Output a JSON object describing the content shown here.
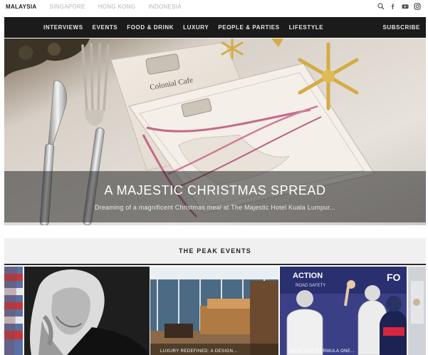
{
  "regions": {
    "items": [
      "MALAYSIA",
      "SINGAPORE",
      "HONG KONG",
      "INDONESIA"
    ],
    "active": "MALAYSIA"
  },
  "social": [
    "search-icon",
    "facebook-icon",
    "youtube-icon",
    "instagram-icon"
  ],
  "nav": {
    "items": [
      "INTERVIEWS",
      "EVENTS",
      "FOOD & DRINK",
      "LUXURY",
      "PEOPLE & PARTIES",
      "LIFESTYLE"
    ],
    "subscribe": "SUBSCRIBE"
  },
  "hero": {
    "headline": "A MAJESTIC CHRISTMAS SPREAD",
    "subline": "Dreaming of a magnificent Christmas meal at The Majestic Hotel Kuala Lumpur...",
    "menu_card_text": "Colonial Cafe"
  },
  "section": {
    "title": "THE PEAK EVENTS"
  },
  "carousel": {
    "cards": [
      {
        "label": ""
      },
      {
        "label": ""
      },
      {
        "label": "LUXURY REDEFINED: A DESIGN..."
      },
      {
        "label": "RACE DAY: FORMULA ONE..."
      },
      {
        "label": ""
      }
    ],
    "banner_text": "ACTION",
    "banner_subtext": "ROAD SAFETY",
    "fo_text": "FO"
  },
  "colors": {
    "nav_bg": "#1b1b1b",
    "section_bg": "#f0f0f0",
    "accent_gold": "#c9a24a"
  }
}
